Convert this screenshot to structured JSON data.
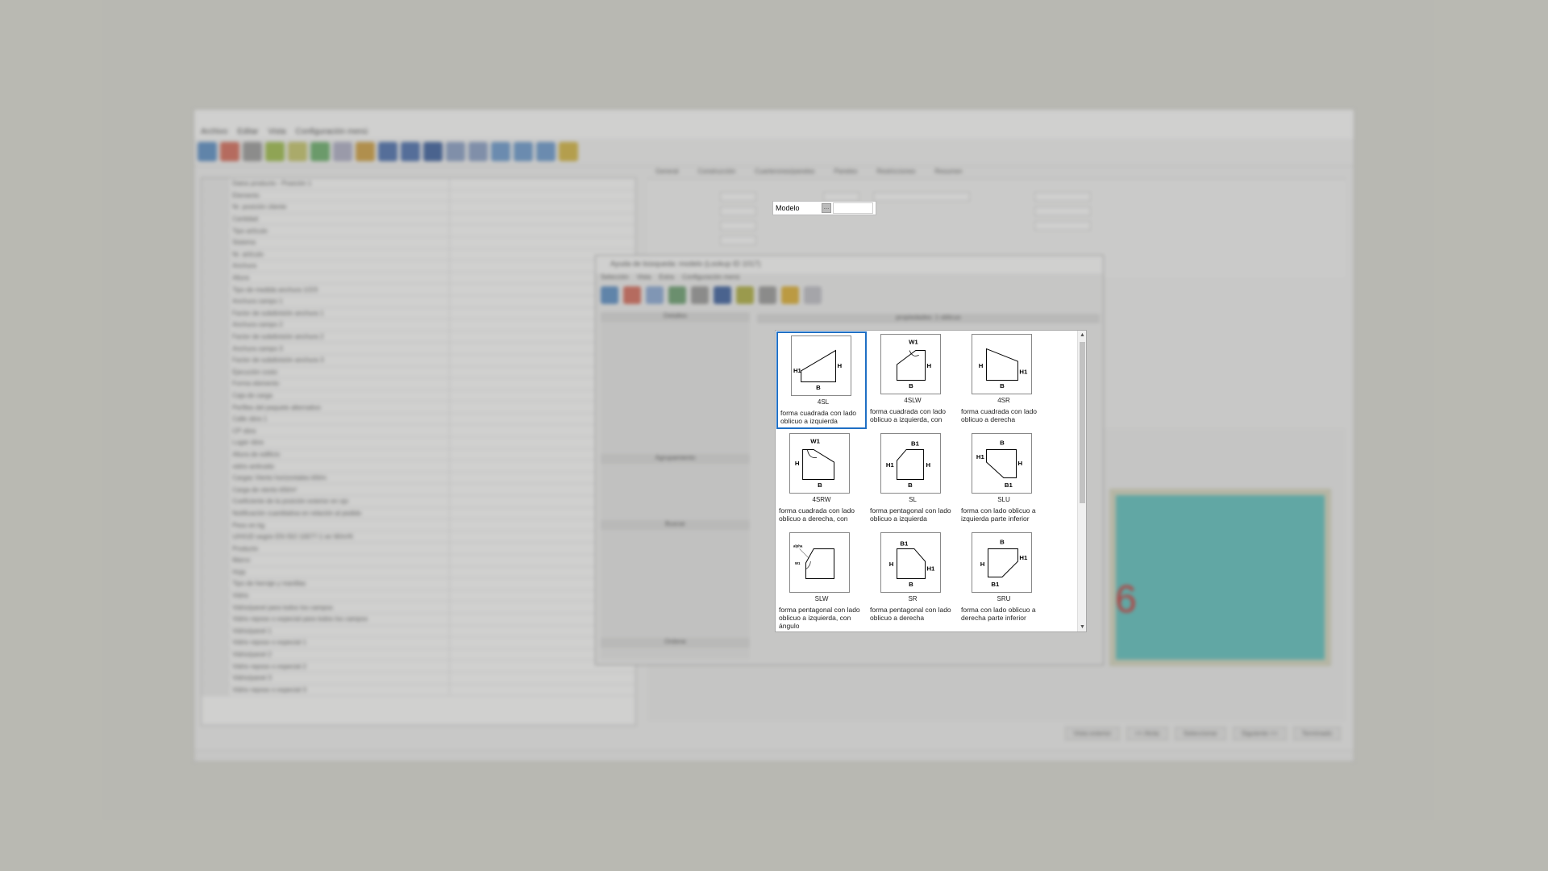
{
  "background_app": {
    "menu": [
      "Archivo",
      "Editar",
      "Vista",
      "Configuración menú"
    ],
    "tabs": [
      "General",
      "Construcción",
      "Cuarterones/paneles",
      "Paneles",
      "Restricciones",
      "Resumen"
    ],
    "grid_rows": [
      "Datos producto - Posición 1",
      "Elemento",
      "Nr. posición cliente",
      "Cantidad",
      "Tipo artículo",
      "Sistema",
      "Nr. artículo",
      "Anchura",
      "Altura",
      "Tipo de medida anchura 1/2/3",
      "Anchura campo 1",
      "Factor de subdivisión anchura 1",
      "Anchura campo 2",
      "Factor de subdivisión anchura 2",
      "Anchura campo 3",
      "Factor de subdivisión anchura 3",
      "Ejecución costo",
      "Forma elemento",
      "Caja de carga",
      "Perfiles del paquete alternativo",
      "Calle obra 1",
      "CP obra",
      "Lugar obra",
      "Altura de edificio",
      "vidrio antiruido",
      "Cargas Viento horizontales kN/m",
      "Carga de viento kN/m²",
      "Coeficiente de la posición exterior en ojo",
      "Notificación cuantitativa en relación al pedido",
      "Peso en kg",
      "U/H/UD según EN ISO 10077-1 en W/m²K",
      "Producto",
      "Marco",
      "Hoja",
      "Tipo de herraje y manillas",
      "Vidrio",
      "Vidrio/panel para todos los campos",
      "Vidrio reposo o especial para todos los campos",
      "Vidrio/panel 1",
      "Vidrio reposo o especial 1",
      "Vidrio/panel 2",
      "Vidrio reposo o especial 2",
      "Vidrio/panel 3",
      "Vidrio reposo o especial 3"
    ],
    "status_buttons": [
      "Vista exterior",
      "<< Atrás",
      "Seleccionar",
      "Siguiente >>",
      "Terminado"
    ],
    "drawing_label": "6",
    "frame_color": "#5cc3c0"
  },
  "dialog": {
    "title": "Ayuda de búsqueda: modelo (Lookup ID 1017)",
    "menu": [
      "Selección",
      "Vista",
      "Extra",
      "Configuración menú"
    ],
    "left_panels": [
      "Detalles",
      "Agrupamiento",
      "Buscar",
      "Ordene"
    ],
    "gallery_header": "propiedades: 1 oblicuo"
  },
  "modelo_field": {
    "label": "Modelo",
    "button_label": "…",
    "value": ""
  },
  "gallery": {
    "selected_index": 0,
    "selection_color": "#1f6fc4",
    "items": [
      {
        "code": "4SL",
        "desc": "forma cuadrada con lado oblicuo a izquierda",
        "labels": [
          "H1",
          "H",
          "B"
        ]
      },
      {
        "code": "4SLW",
        "desc": "forma cuadrada con lado oblicuo a izquierda, con",
        "labels": [
          "W1",
          "H",
          "B"
        ]
      },
      {
        "code": "4SR",
        "desc": "forma cuadrada con lado oblicuo a derecha",
        "labels": [
          "H",
          "H1",
          "B"
        ]
      },
      {
        "code": "4SRW",
        "desc": "forma cuadrada con lado oblicuo a derecha, con",
        "labels": [
          "W1",
          "H",
          "B"
        ]
      },
      {
        "code": "SL",
        "desc": "forma pentagonal con lado oblicuo a izquierda",
        "labels": [
          "B1",
          "H1",
          "H",
          "B"
        ]
      },
      {
        "code": "SLU",
        "desc": "forma con lado oblicuo a izquierda parte inferior",
        "labels": [
          "B",
          "H1",
          "H",
          "B1"
        ]
      },
      {
        "code": "SLW",
        "desc": "forma pentagonal con lado oblicuo a izquierda, con ángulo",
        "labels": [
          "alpha",
          "W1"
        ]
      },
      {
        "code": "SR",
        "desc": "forma pentagonal con lado oblicuo a derecha",
        "labels": [
          "B1",
          "H",
          "H1",
          "B"
        ]
      },
      {
        "code": "SRU",
        "desc": "forma con lado oblicuo a derecha parte inferior",
        "labels": [
          "B",
          "H",
          "H1",
          "B1"
        ]
      }
    ],
    "scroll_up": "▲",
    "scroll_down": "▼"
  }
}
